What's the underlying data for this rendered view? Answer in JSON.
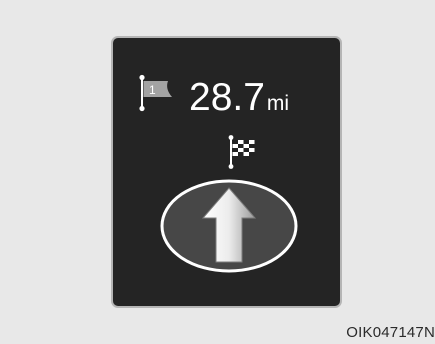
{
  "display": {
    "waypoint_number": "1",
    "distance_value": "28.7",
    "distance_unit": "mi",
    "direction": "straight-ahead"
  },
  "caption": {
    "image_code": "OIK047147N"
  },
  "icons": {
    "waypoint": "waypoint-flag-icon",
    "destination": "checkered-flag-icon",
    "direction": "straight-arrow-icon"
  },
  "colors": {
    "page_background": "#e8e8e8",
    "panel_background": "#242424",
    "panel_border": "#b5b5b5",
    "text": "#ffffff"
  }
}
